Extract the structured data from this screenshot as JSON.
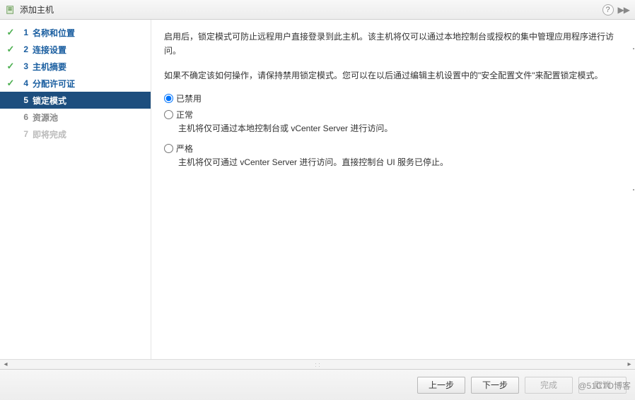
{
  "titlebar": {
    "title": "添加主机",
    "help_tooltip": "?"
  },
  "sidebar": {
    "steps": [
      {
        "num": "1",
        "label": "名称和位置",
        "state": "completed"
      },
      {
        "num": "2",
        "label": "连接设置",
        "state": "completed"
      },
      {
        "num": "3",
        "label": "主机摘要",
        "state": "completed"
      },
      {
        "num": "4",
        "label": "分配许可证",
        "state": "completed"
      },
      {
        "num": "5",
        "label": "锁定模式",
        "state": "active"
      },
      {
        "num": "6",
        "label": "资源池",
        "state": "future"
      },
      {
        "num": "7",
        "label": "即将完成",
        "state": "disabled"
      }
    ]
  },
  "main": {
    "para1": "启用后，锁定模式可防止远程用户直接登录到此主机。该主机将仅可以通过本地控制台或授权的集中管理应用程序进行访问。",
    "para2": "如果不确定该如何操作，请保持禁用锁定模式。您可以在以后通过编辑主机设置中的\"安全配置文件\"来配置锁定模式。",
    "options": [
      {
        "value": "disabled",
        "label": "已禁用",
        "desc": "",
        "checked": true
      },
      {
        "value": "normal",
        "label": "正常",
        "desc": "主机将仅可通过本地控制台或 vCenter Server 进行访问。",
        "checked": false
      },
      {
        "value": "strict",
        "label": "严格",
        "desc": "主机将仅可通过 vCenter Server 进行访问。直接控制台 UI 服务已停止。",
        "checked": false
      }
    ]
  },
  "footer": {
    "back": "上一步",
    "next": "下一步",
    "finish": "完成",
    "cancel": "取消"
  },
  "watermark": "@51CTO博客"
}
